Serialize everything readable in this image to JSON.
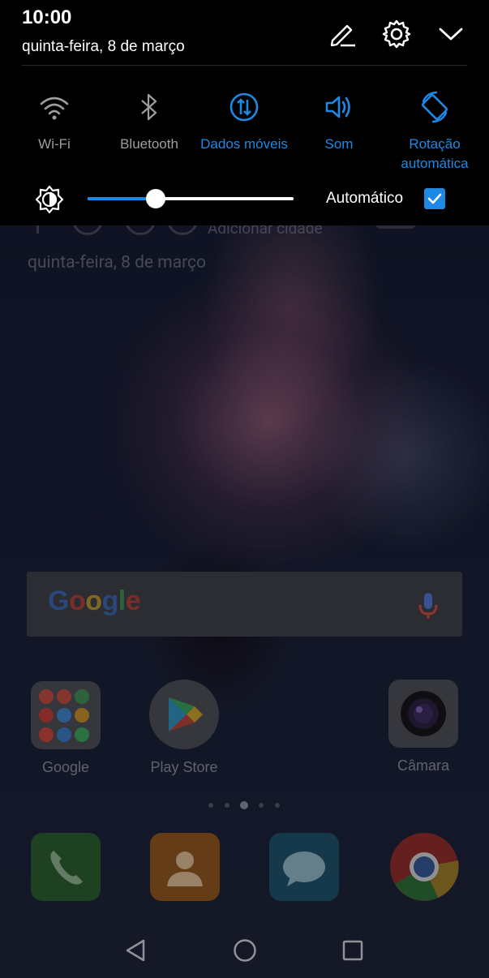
{
  "status": {
    "time": "10:00",
    "date": "quinta-feira, 8 de março"
  },
  "header_icons": [
    "edit-icon",
    "settings-icon",
    "collapse-icon"
  ],
  "toggles": [
    {
      "label": "Wi-Fi",
      "icon": "wifi-icon",
      "active": false
    },
    {
      "label": "Bluetooth",
      "icon": "bluetooth-icon",
      "active": false
    },
    {
      "label": "Dados móveis",
      "icon": "mobile-data-icon",
      "active": true
    },
    {
      "label": "Som",
      "icon": "sound-icon",
      "active": true
    },
    {
      "label": "Rotação\nautomática",
      "icon": "auto-rotate-icon",
      "active": true
    }
  ],
  "brightness": {
    "level": 0.33,
    "auto_label": "Automático",
    "auto_checked": true
  },
  "colors": {
    "accent": "#1e88e5",
    "inactive": "#9e9e9e",
    "shade_bg": "#000000"
  },
  "home": {
    "weather_city": "Adicionar cidade",
    "date": "quinta-feira, 8 de março",
    "search_logo": "Google",
    "apps": [
      {
        "label": "Google",
        "icon": "google-folder-icon"
      },
      {
        "label": "Play Store",
        "icon": "play-store-icon"
      },
      {
        "label": "Câmara",
        "icon": "camera-icon"
      }
    ],
    "page_count": 5,
    "active_page": 3,
    "dock": [
      {
        "name": "phone",
        "icon": "phone-icon"
      },
      {
        "name": "contacts",
        "icon": "contacts-icon"
      },
      {
        "name": "messages",
        "icon": "messages-icon"
      },
      {
        "name": "chrome",
        "icon": "chrome-icon"
      }
    ]
  },
  "navbar": [
    "back-icon",
    "home-icon",
    "recents-icon"
  ]
}
